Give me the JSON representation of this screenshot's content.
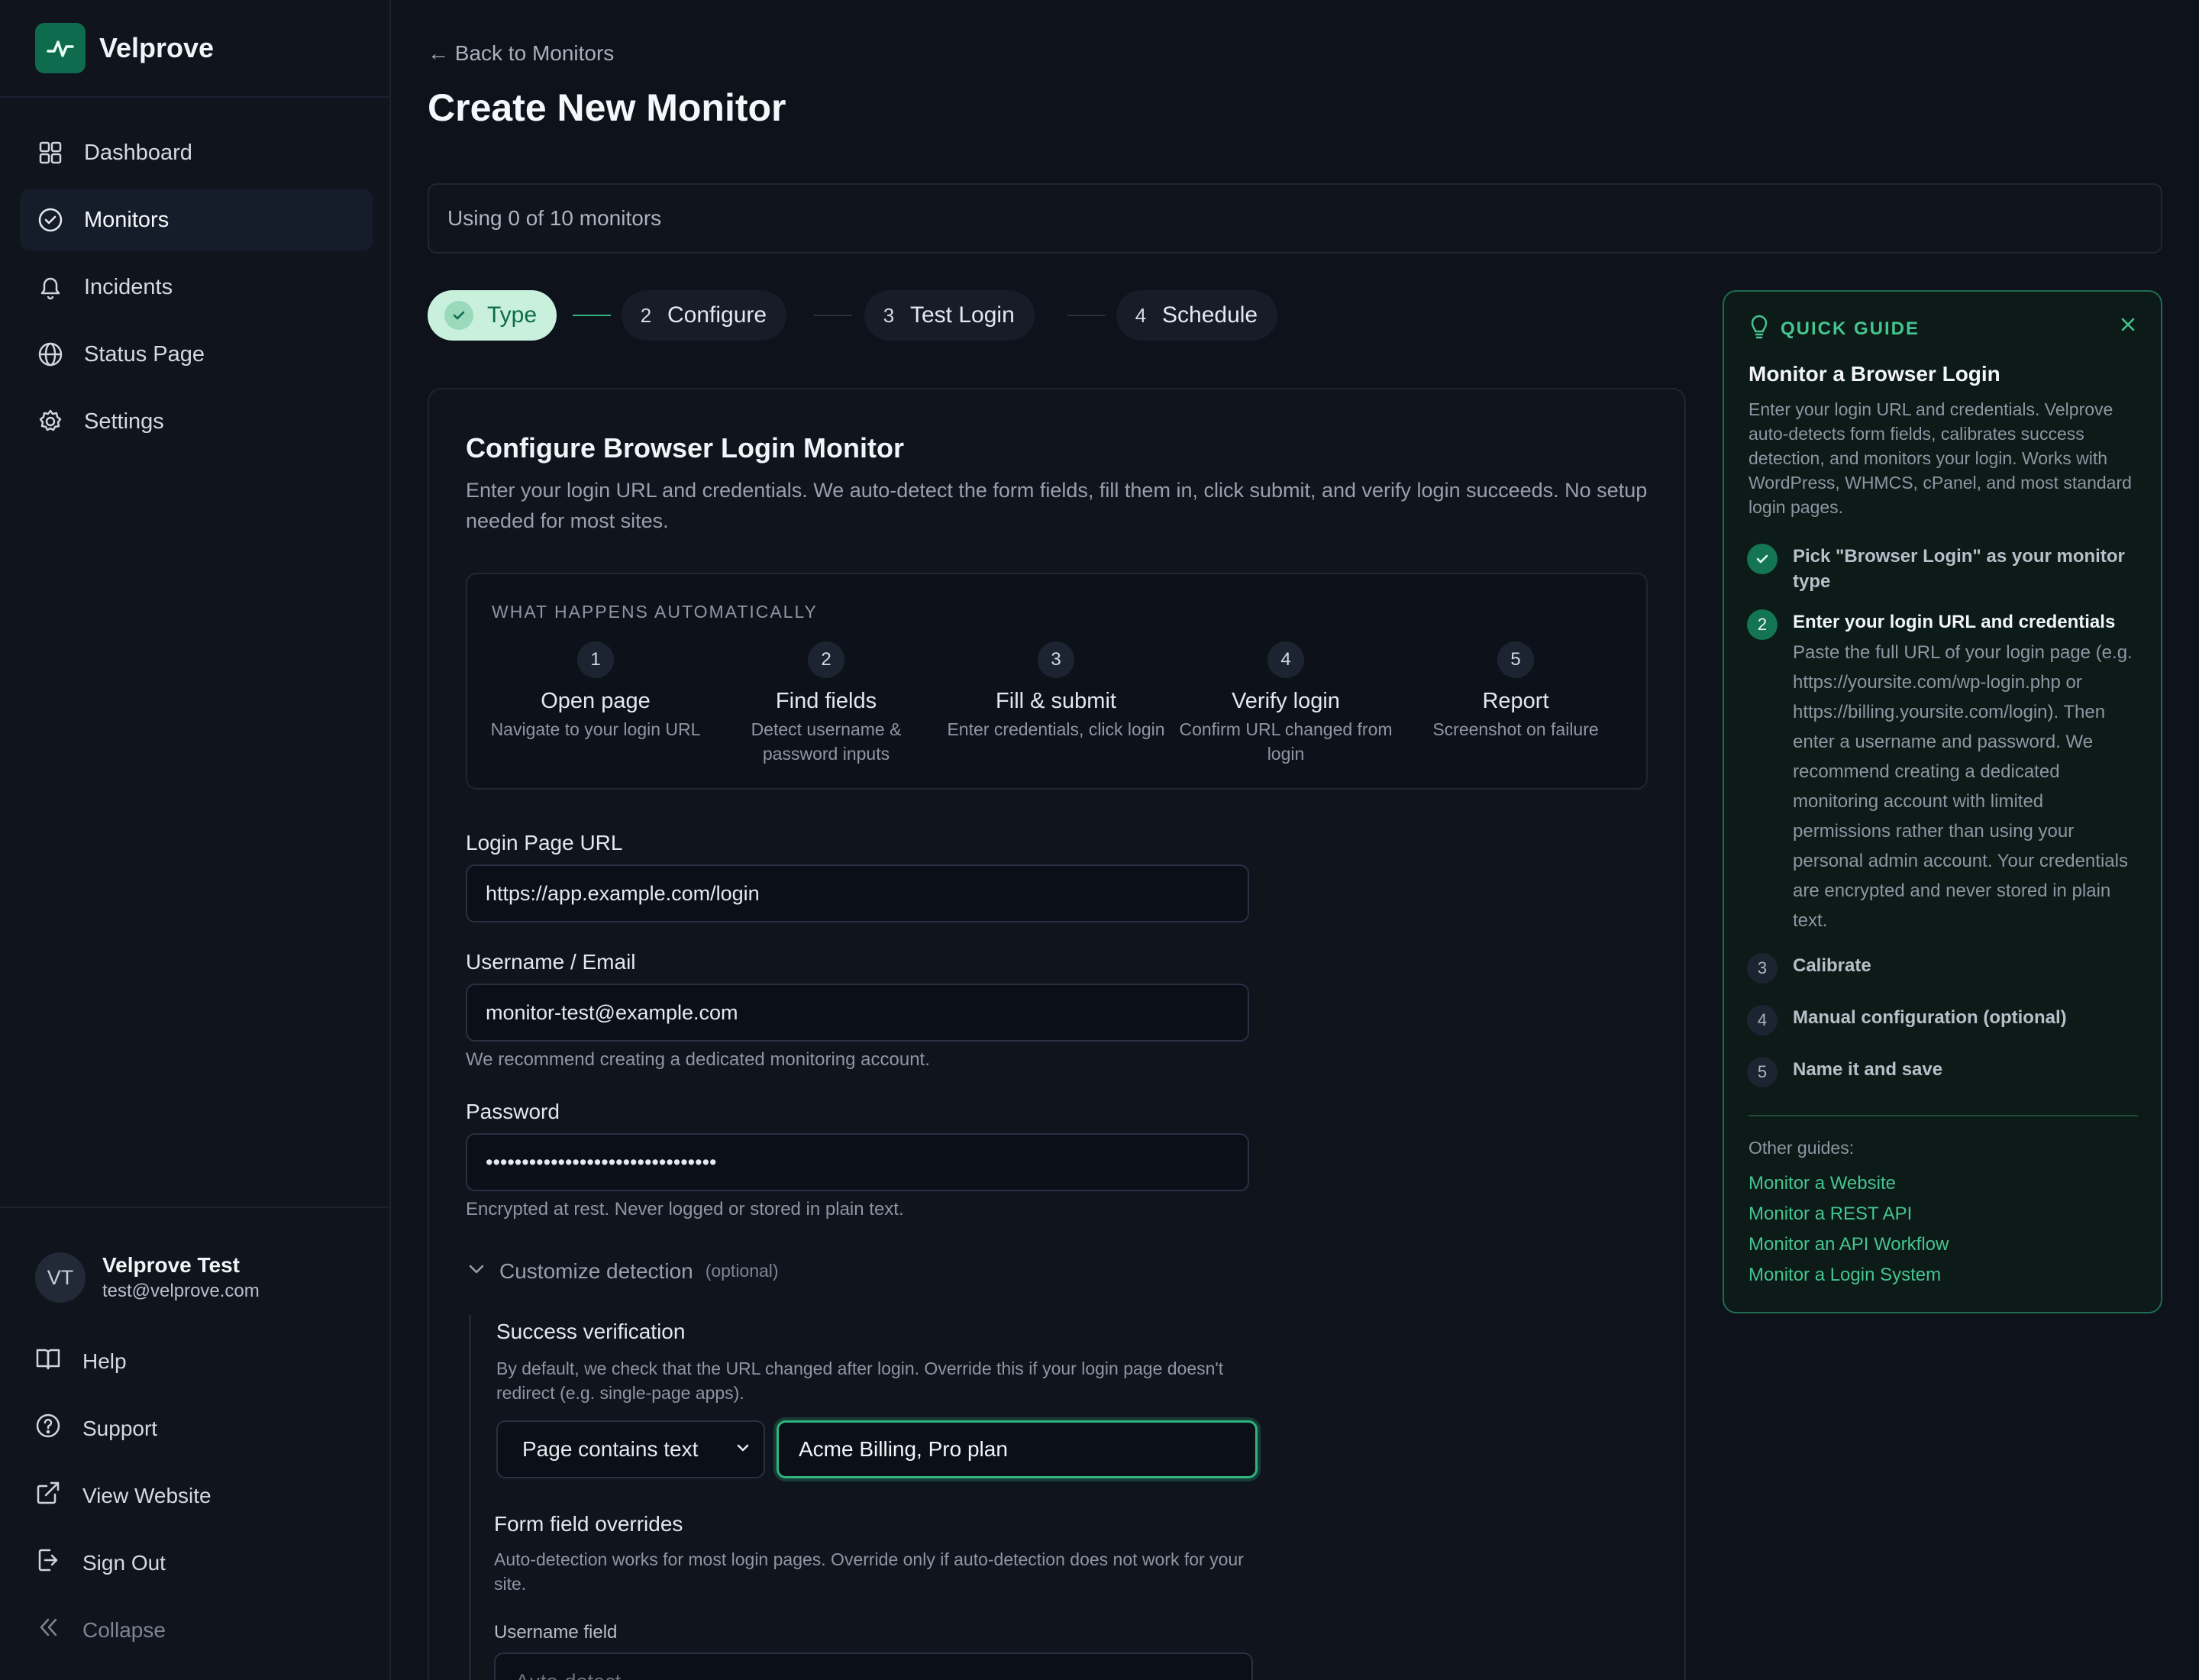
{
  "brand": {
    "name": "Velprove"
  },
  "nav": [
    {
      "label": "Dashboard",
      "icon": "grid-icon",
      "active": false
    },
    {
      "label": "Monitors",
      "icon": "check-circle-icon",
      "active": true
    },
    {
      "label": "Incidents",
      "icon": "bell-icon",
      "active": false
    },
    {
      "label": "Status Page",
      "icon": "globe-icon",
      "active": false
    },
    {
      "label": "Settings",
      "icon": "gear-icon",
      "active": false
    }
  ],
  "user": {
    "initials": "VT",
    "name": "Velprove Test",
    "email": "test@velprove.com"
  },
  "bottom_nav": [
    {
      "label": "Help",
      "icon": "book-icon"
    },
    {
      "label": "Support",
      "icon": "help-circle-icon"
    },
    {
      "label": "View Website",
      "icon": "external-link-icon"
    },
    {
      "label": "Sign Out",
      "icon": "sign-out-icon"
    },
    {
      "label": "Collapse",
      "icon": "double-chevron-left-icon"
    }
  ],
  "header": {
    "back_label": "← Back to Monitors",
    "title": "Create New Monitor"
  },
  "usage": {
    "text": "Using 0 of 10 monitors"
  },
  "stepper": [
    {
      "num": "1",
      "label": "Type",
      "state": "done"
    },
    {
      "num": "2",
      "label": "Configure",
      "state": "current"
    },
    {
      "num": "3",
      "label": "Test Login",
      "state": "upcoming"
    },
    {
      "num": "4",
      "label": "Schedule",
      "state": "upcoming"
    }
  ],
  "config": {
    "title": "Configure Browser Login Monitor",
    "description": "Enter your login URL and credentials. We auto-detect the form fields, fill them in, click submit, and verify login succeeds. No setup needed for most sites.",
    "auto_label": "WHAT HAPPENS AUTOMATICALLY",
    "auto_steps": [
      {
        "num": "1",
        "title": "Open page",
        "sub": "Navigate to your login URL"
      },
      {
        "num": "2",
        "title": "Find fields",
        "sub": "Detect username & password inputs"
      },
      {
        "num": "3",
        "title": "Fill & submit",
        "sub": "Enter credentials, click login"
      },
      {
        "num": "4",
        "title": "Verify login",
        "sub": "Confirm URL changed from login"
      },
      {
        "num": "5",
        "title": "Report",
        "sub": "Screenshot on failure"
      }
    ],
    "login_url": {
      "label": "Login Page URL",
      "value": "https://app.example.com/login"
    },
    "username": {
      "label": "Username / Email",
      "value": "monitor-test@example.com",
      "hint": "We recommend creating a dedicated monitoring account."
    },
    "password": {
      "label": "Password",
      "value": "••••••••••••••••••••••••••••••••",
      "hint": "Encrypted at rest. Never logged or stored in plain text."
    },
    "customize": {
      "label": "Customize detection",
      "optional": "(optional)"
    },
    "success": {
      "title": "Success verification",
      "desc": "By default, we check that the URL changed after login. Override this if your login page doesn't redirect (e.g. single-page apps).",
      "select_value": "Page contains text",
      "text_value": "Acme Billing, Pro plan"
    },
    "overrides": {
      "title": "Form field overrides",
      "desc": "Auto-detection works for most login pages. Override only if auto-detection does not work for your site.",
      "username_label": "Username field",
      "username_placeholder": "Auto-detect"
    }
  },
  "guide": {
    "tag": "QUICK GUIDE",
    "title": "Monitor a Browser Login",
    "intro": "Enter your login URL and credentials. Velprove auto-detects form fields, calibrates success detection, and monitors your login. Works with WordPress, WHMCS, cPanel, and most standard login pages.",
    "steps": [
      {
        "num": "1",
        "text": "Pick \"Browser Login\" as your monitor type",
        "state": "done"
      },
      {
        "num": "2",
        "text": "Enter your login URL and credentials",
        "state": "current",
        "body": "Paste the full URL of your login page (e.g. https://yoursite.com/wp-login.php or https://billing.yoursite.com/login). Then enter a username and password. We recommend creating a dedicated monitoring account with limited permissions rather than using your personal admin account. Your credentials are encrypted and never stored in plain text."
      },
      {
        "num": "3",
        "text": "Calibrate",
        "state": "upcoming"
      },
      {
        "num": "4",
        "text": "Manual configuration (optional)",
        "state": "upcoming"
      },
      {
        "num": "5",
        "text": "Name it and save",
        "state": "upcoming"
      }
    ],
    "other_label": "Other guides:",
    "other_links": [
      "Monitor a Website",
      "Monitor a REST API",
      "Monitor an API Workflow",
      "Monitor a Login System"
    ]
  },
  "colors": {
    "accent": "#2fb37f",
    "brand": "#0f6b4e",
    "background": "#0d121b"
  }
}
